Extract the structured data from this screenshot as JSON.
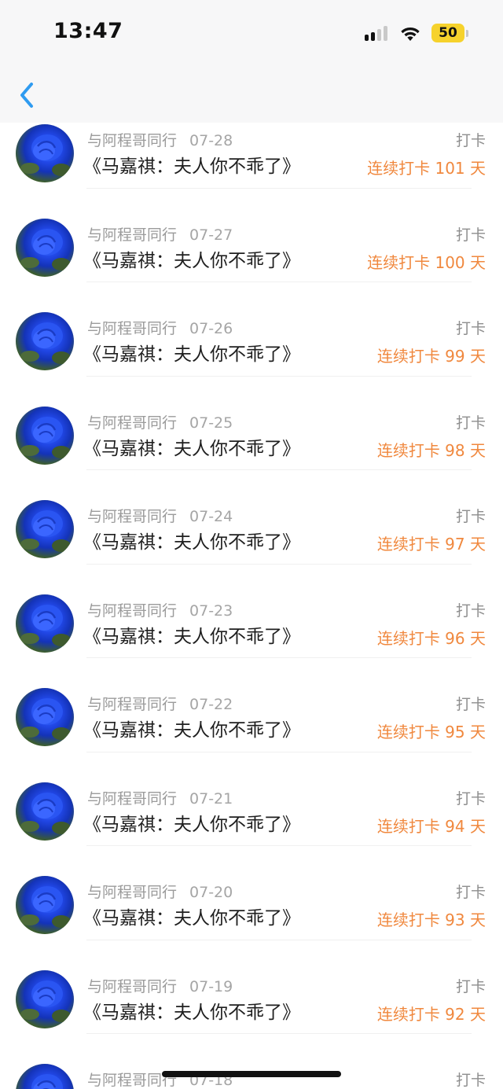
{
  "status_bar": {
    "time": "13:47",
    "battery": "50",
    "colors": {
      "battery": "#f6d22c"
    }
  },
  "nav": {
    "back_icon": "chevron-left-icon",
    "accent": "#2f9bf0"
  },
  "list": {
    "items": [
      {
        "author": "与阿程哥同行",
        "date": "07-28",
        "title": "《马嘉祺：夫人你不乖了》",
        "tag": "打卡",
        "streak": "连续打卡 101 天"
      },
      {
        "author": "与阿程哥同行",
        "date": "07-27",
        "title": "《马嘉祺：夫人你不乖了》",
        "tag": "打卡",
        "streak": "连续打卡 100 天"
      },
      {
        "author": "与阿程哥同行",
        "date": "07-26",
        "title": "《马嘉祺：夫人你不乖了》",
        "tag": "打卡",
        "streak": "连续打卡 99 天"
      },
      {
        "author": "与阿程哥同行",
        "date": "07-25",
        "title": "《马嘉祺：夫人你不乖了》",
        "tag": "打卡",
        "streak": "连续打卡 98 天"
      },
      {
        "author": "与阿程哥同行",
        "date": "07-24",
        "title": "《马嘉祺：夫人你不乖了》",
        "tag": "打卡",
        "streak": "连续打卡 97 天"
      },
      {
        "author": "与阿程哥同行",
        "date": "07-23",
        "title": "《马嘉祺：夫人你不乖了》",
        "tag": "打卡",
        "streak": "连续打卡 96 天"
      },
      {
        "author": "与阿程哥同行",
        "date": "07-22",
        "title": "《马嘉祺：夫人你不乖了》",
        "tag": "打卡",
        "streak": "连续打卡 95 天"
      },
      {
        "author": "与阿程哥同行",
        "date": "07-21",
        "title": "《马嘉祺：夫人你不乖了》",
        "tag": "打卡",
        "streak": "连续打卡 94 天"
      },
      {
        "author": "与阿程哥同行",
        "date": "07-20",
        "title": "《马嘉祺：夫人你不乖了》",
        "tag": "打卡",
        "streak": "连续打卡 93 天"
      },
      {
        "author": "与阿程哥同行",
        "date": "07-19",
        "title": "《马嘉祺：夫人你不乖了》",
        "tag": "打卡",
        "streak": "连续打卡 92 天"
      },
      {
        "author": "与阿程哥同行",
        "date": "07-18",
        "title": "",
        "tag": "打卡",
        "streak": ""
      }
    ],
    "colors": {
      "streak": "#f0883e",
      "meta": "#9b9b9b"
    }
  }
}
